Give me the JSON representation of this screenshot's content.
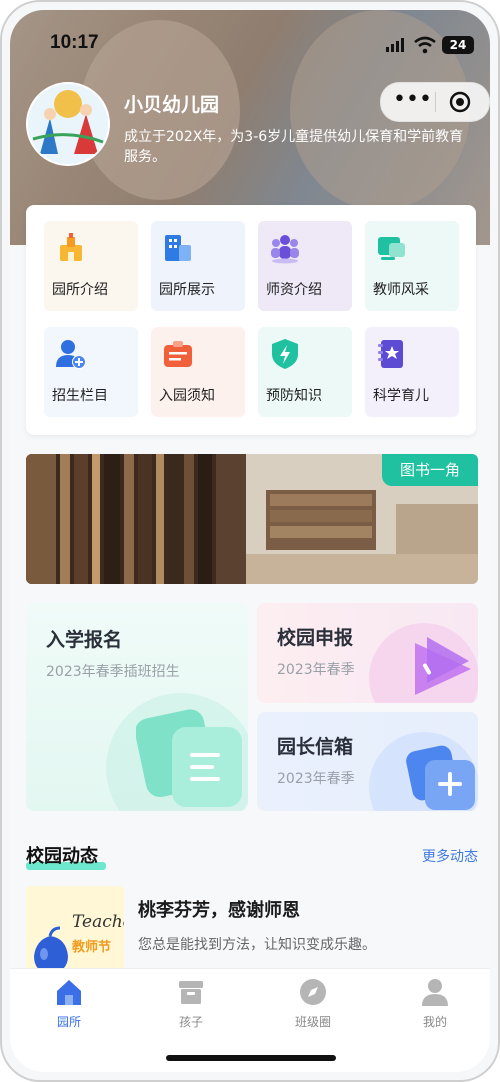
{
  "status_bar": {
    "time": "10:17",
    "battery": "24"
  },
  "header": {
    "school_name": "小贝幼儿园",
    "description": "成立于202X年，为3-6岁儿童提供幼儿保育和学前教育服务。"
  },
  "menu": {
    "items": [
      {
        "label": "园所介绍",
        "icon": "school-building-icon",
        "bg": "#fbf6ee",
        "color": "#f5a623"
      },
      {
        "label": "园所展示",
        "icon": "buildings-icon",
        "bg": "#eef3fc",
        "color": "#2f7be5"
      },
      {
        "label": "师资介绍",
        "icon": "teachers-group-icon",
        "bg": "#efe9f7",
        "color": "#6b4fd8"
      },
      {
        "label": "教师风采",
        "icon": "teacher-card-icon",
        "bg": "#edf9f6",
        "color": "#1fc1a0"
      },
      {
        "label": "招生栏目",
        "icon": "add-user-icon",
        "bg": "#eef3fc",
        "color": "#2f6fe0"
      },
      {
        "label": "入园须知",
        "icon": "notice-icon",
        "bg": "#fdf1ee",
        "color": "#f0603a"
      },
      {
        "label": "预防知识",
        "icon": "shield-lightning-icon",
        "bg": "#edf9f6",
        "color": "#1fc1a0"
      },
      {
        "label": "科学育儿",
        "icon": "star-book-icon",
        "bg": "#f3f0fb",
        "color": "#5d4bd3"
      }
    ]
  },
  "library": {
    "tag": "图书一角"
  },
  "promos": {
    "enroll": {
      "title": "入学报名",
      "subtitle": "2023年春季插班招生"
    },
    "report": {
      "title": "校园申报",
      "subtitle": "2023年春季"
    },
    "mailbox": {
      "title": "园长信箱",
      "subtitle": "2023年春季"
    }
  },
  "news": {
    "section_title": "校园动态",
    "more": "更多动态",
    "items": [
      {
        "title": "桃李芬芳，感谢师恩",
        "desc": "您总是能找到方法，让知识变成乐趣。",
        "thumb_en": "Teache",
        "thumb_cn": "教师节"
      }
    ]
  },
  "tabbar": {
    "tabs": [
      {
        "label": "园所",
        "icon": "home-icon",
        "active": true
      },
      {
        "label": "孩子",
        "icon": "box-icon",
        "active": false
      },
      {
        "label": "班级圈",
        "icon": "compass-icon",
        "active": false
      },
      {
        "label": "我的",
        "icon": "person-icon",
        "active": false
      }
    ]
  },
  "colors": {
    "accent": "#1fc1a0",
    "tab_active": "#3a6fe8",
    "more_link": "#3f7ae0"
  }
}
